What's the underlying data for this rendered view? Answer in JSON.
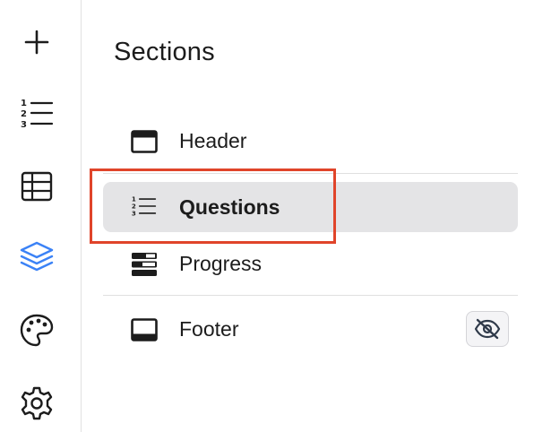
{
  "sidebar": {
    "icons": [
      "plus-icon",
      "numbered-list-icon",
      "table-icon",
      "layers-icon",
      "palette-icon",
      "gear-icon"
    ],
    "active_color": "#3b82f6"
  },
  "panel": {
    "title": "Sections",
    "items": [
      {
        "label": "Header",
        "icon": "header-layout-icon"
      },
      {
        "label": "Questions",
        "icon": "numbered-list-icon",
        "selected": true
      },
      {
        "label": "Progress",
        "icon": "progress-bars-icon"
      },
      {
        "label": "Footer",
        "icon": "footer-layout-icon",
        "hidden_toggle_icon": "eye-off-icon"
      }
    ]
  },
  "colors": {
    "highlight": "#e0442a",
    "selected_bg": "#e4e4e6"
  }
}
